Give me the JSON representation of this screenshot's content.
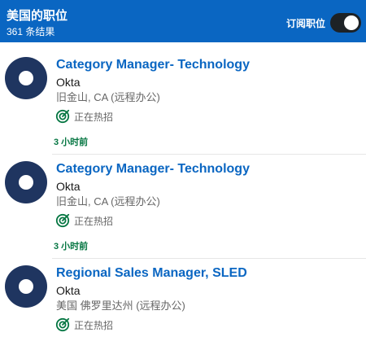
{
  "header": {
    "title": "美国的职位",
    "result_count": "361 条结果",
    "subscribe_label": "订阅职位",
    "subscribe_toggle_on": true
  },
  "colors": {
    "header_bg": "#0a66c2",
    "title_link": "#0a66c2",
    "posted_green": "#057642",
    "logo_navy": "#1f3560"
  },
  "jobs": [
    {
      "title": "Category Manager- Technology",
      "company": "Okta",
      "location": "旧金山, CA (远程办公)",
      "status": "正在热招",
      "status_icon": "target-icon",
      "posted": "3 小时前"
    },
    {
      "title": "Category Manager- Technology",
      "company": "Okta",
      "location": "旧金山, CA (远程办公)",
      "status": "正在热招",
      "status_icon": "target-icon",
      "posted": "3 小时前"
    },
    {
      "title": "Regional Sales Manager, SLED",
      "company": "Okta",
      "location": "美国 佛罗里达州 (远程办公)",
      "status": "正在热招",
      "status_icon": "target-icon",
      "posted": ""
    }
  ]
}
